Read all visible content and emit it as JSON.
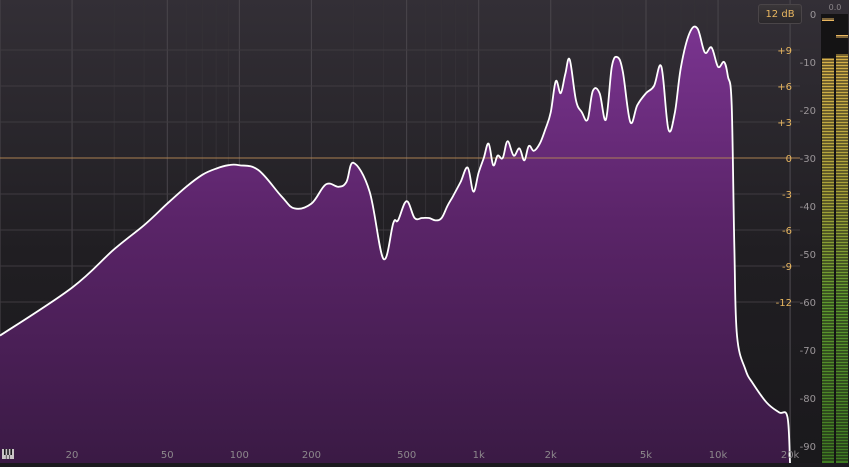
{
  "range_button": "12 dB",
  "db_labels": [
    "+9",
    "+6",
    "+3",
    "0",
    "-3",
    "-6",
    "-9",
    "-12"
  ],
  "level_labels": [
    "-10",
    "-20",
    "-30",
    "-40",
    "-50",
    "-60",
    "-70",
    "-80",
    "-90"
  ],
  "top_level_label": "0",
  "meter_peak": "0.0",
  "freq_labels": [
    "20",
    "50",
    "100",
    "200",
    "500",
    "1k",
    "2k",
    "5k",
    "10k",
    "20k"
  ],
  "colors": {
    "accent": "#e9b760",
    "fill": "#5e2a6a",
    "curve": "#ffffff",
    "meter": "#5c9a2e"
  },
  "chart_data": {
    "type": "area",
    "x": [
      10,
      20,
      30,
      40,
      50,
      60,
      70,
      80,
      90,
      100,
      120,
      150,
      170,
      200,
      230,
      260,
      280,
      300,
      350,
      400,
      440,
      460,
      500,
      540,
      580,
      620,
      660,
      700,
      740,
      780,
      840,
      900,
      950,
      1000,
      1050,
      1100,
      1150,
      1200,
      1260,
      1320,
      1400,
      1480,
      1550,
      1620,
      1700,
      1800,
      1900,
      2000,
      2100,
      2200,
      2300,
      2400,
      2550,
      2700,
      2850,
      3000,
      3200,
      3400,
      3600,
      3800,
      4000,
      4300,
      4600,
      5000,
      5400,
      5800,
      6200,
      6600,
      7000,
      7600,
      8200,
      8800,
      9400,
      10000,
      10600,
      11000,
      11400,
      11700,
      12000,
      13000,
      14000,
      16000,
      18000,
      19500,
      20000
    ],
    "y": [
      -67,
      -57,
      -49,
      -44,
      -39.5,
      -36,
      -33.5,
      -32.2,
      -31.5,
      -31.5,
      -32.5,
      -38,
      -40.5,
      -39.5,
      -35.5,
      -36,
      -35,
      -31,
      -37,
      -51,
      -43.5,
      -43,
      -39,
      -42.5,
      -42.5,
      -42.5,
      -43,
      -42.5,
      -40,
      -38,
      -35,
      -32,
      -37,
      -33,
      -30,
      -27,
      -31.5,
      -29.5,
      -30,
      -26.5,
      -29.5,
      -28,
      -30.5,
      -27.5,
      -28.5,
      -27,
      -24,
      -20.5,
      -14,
      -16.5,
      -12.5,
      -9.5,
      -18,
      -20.5,
      -22,
      -16,
      -16.5,
      -22,
      -11,
      -9,
      -12,
      -22.5,
      -19,
      -16.5,
      -15,
      -11,
      -24,
      -20.5,
      -11,
      -4,
      -3,
      -8,
      -7,
      -11,
      -10,
      -13,
      -19,
      -49,
      -67,
      -74,
      -77,
      -81,
      -83,
      -84,
      -99
    ],
    "xscale": "log",
    "xlim": [
      10,
      22000
    ],
    "ylim": [
      -95,
      2
    ],
    "grid": true
  }
}
